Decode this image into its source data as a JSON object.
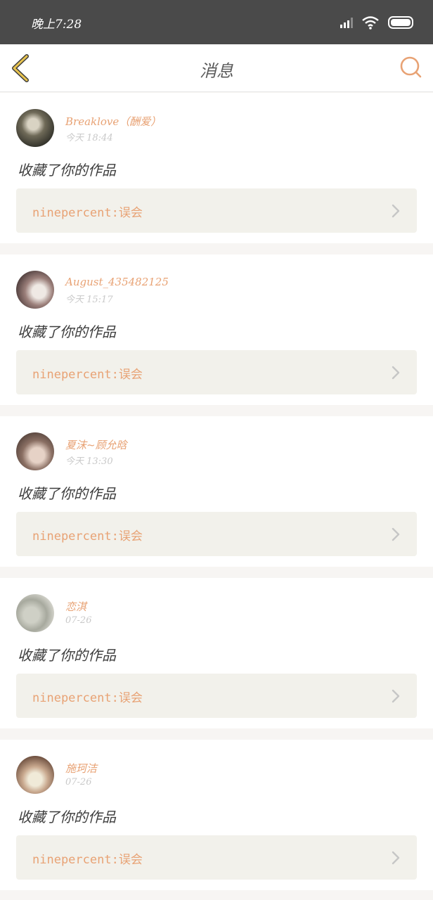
{
  "status_bar": {
    "time": "晚上7:28"
  },
  "nav": {
    "title": "消息"
  },
  "colors": {
    "accent": "#e8a274",
    "back_icon": "#d9b347",
    "card_link_bg": "#f2f1eb"
  },
  "messages": [
    {
      "user": "Breaklove（酬爱）",
      "time": "今天 18:44",
      "action": "收藏了你的作品",
      "work": "ninepercent:误会"
    },
    {
      "user": "August_435482125",
      "time": "今天 15:17",
      "action": "收藏了你的作品",
      "work": "ninepercent:误会"
    },
    {
      "user": "夏沫~顾允晗",
      "time": "今天 13:30",
      "action": "收藏了你的作品",
      "work": "ninepercent:误会"
    },
    {
      "user": "恋淇",
      "time": "07-26",
      "action": "收藏了你的作品",
      "work": "ninepercent:误会"
    },
    {
      "user": "施珂洁",
      "time": "07-26",
      "action": "收藏了你的作品",
      "work": "ninepercent:误会"
    }
  ]
}
